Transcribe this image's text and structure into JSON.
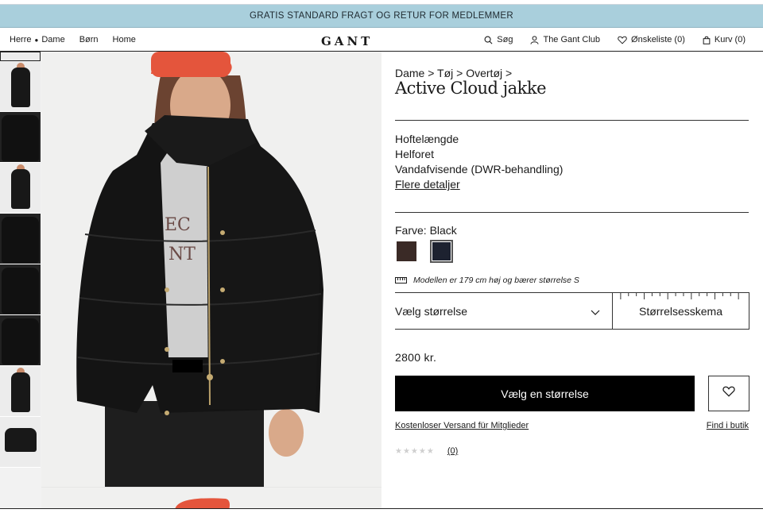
{
  "banner": {
    "text": "GRATIS STANDARD FRAGT OG RETUR FOR MEDLEMMER"
  },
  "nav": {
    "left": [
      "Herre",
      "Dame",
      "Børn",
      "Home"
    ],
    "logo": "GANT",
    "right": {
      "search": "Søg",
      "club": "The Gant Club",
      "wishlist": "Ønskeliste (0)",
      "cart": "Kurv (0)"
    }
  },
  "product": {
    "breadcrumb": "Dame > Tøj > Overtøj >",
    "title": "Active Cloud jakke",
    "features": [
      "Hoftelængde",
      "Helforet",
      "Vandafvisende (DWR-behandling)"
    ],
    "more_details": "Flere detaljer",
    "color_label": "Farve: Black",
    "swatches": [
      {
        "name": "Brown",
        "color": "#3a2a26"
      },
      {
        "name": "Black",
        "color": "#1d2230",
        "selected": true
      }
    ],
    "model_note": "Modellen er 179 cm høj og bærer størrelse S",
    "size_select": "Vælg størrelse",
    "size_chart": "Størrelsesskema",
    "price": "2800 kr.",
    "cta": "Vælg en størrelse",
    "shipping_link": "Kostenloser Versand für Mitglieder",
    "store_link": "Find i butik",
    "rating_stars": "★★★★★",
    "rating_count": "(0)"
  },
  "colors": {
    "banner_bg": "#a9cfdc",
    "cta_bg": "#000000",
    "cap_red": "#e4553c"
  }
}
